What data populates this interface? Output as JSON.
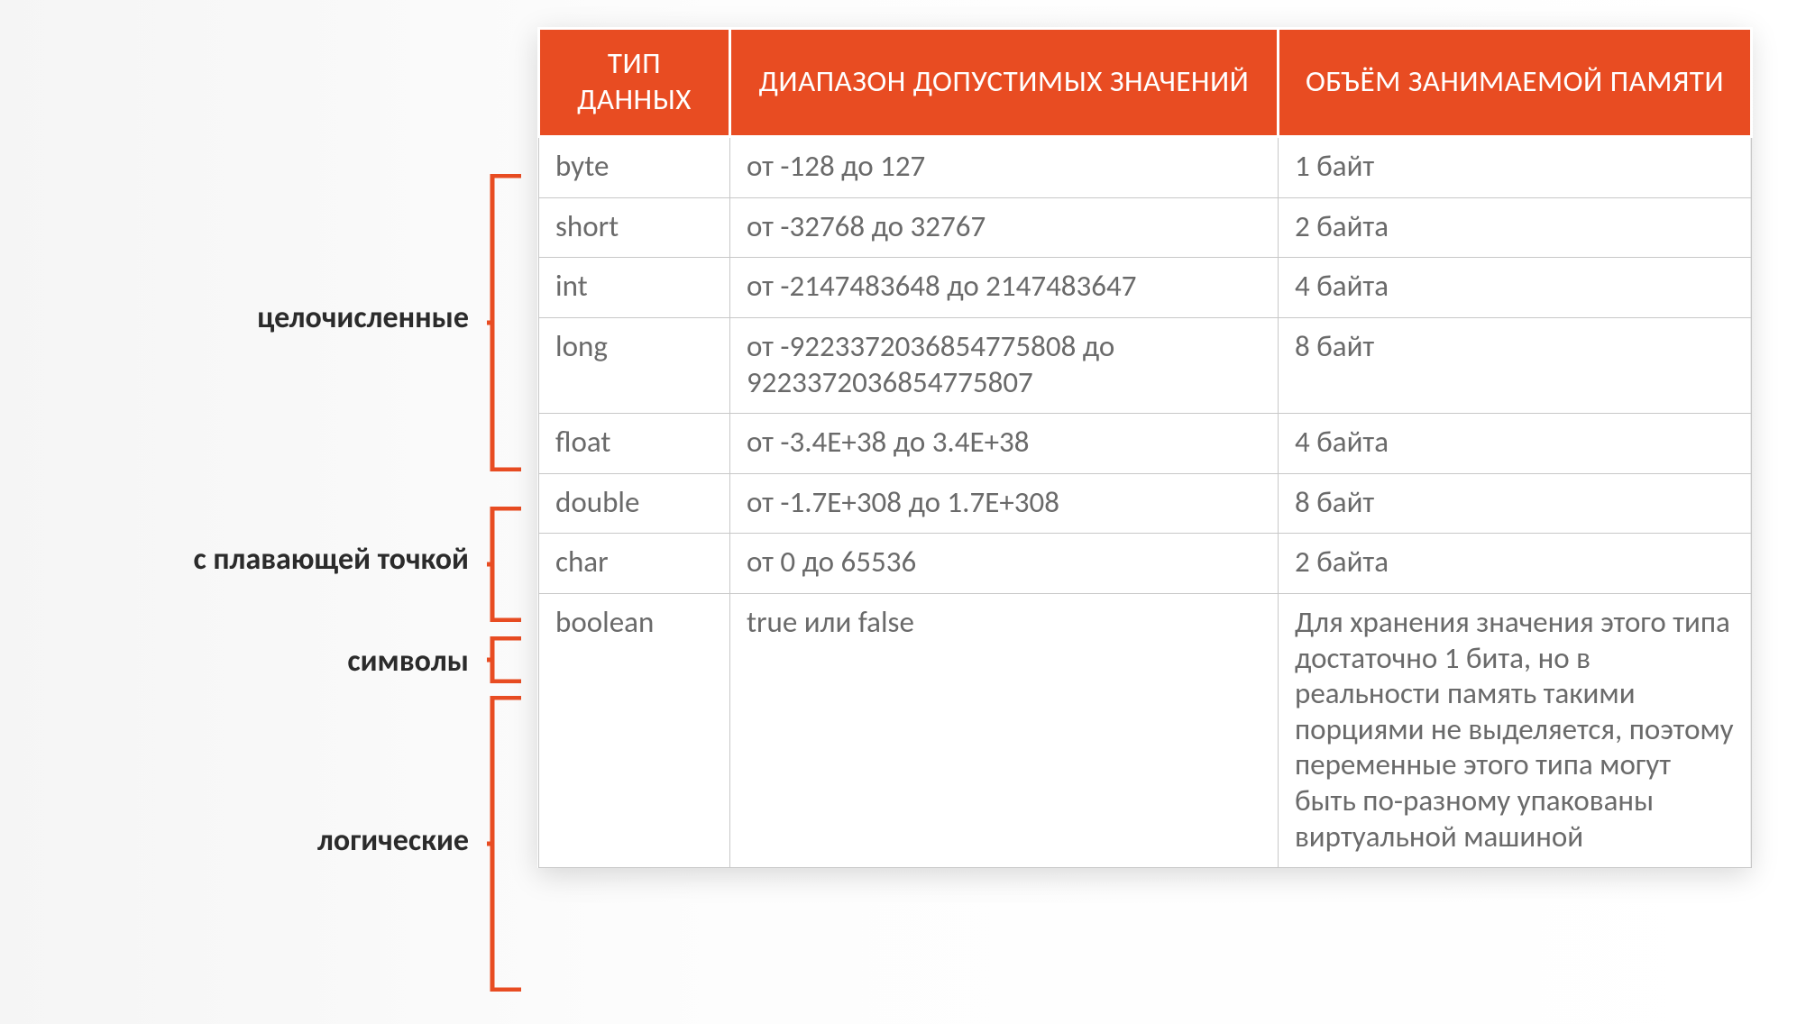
{
  "labels": {
    "integers": "целочисленные",
    "floating": "с плавающей точкой",
    "chars": "символы",
    "logical": "логические"
  },
  "table": {
    "headers": {
      "type": "ТИП ДАННЫХ",
      "range": "ДИАПАЗОН ДОПУСТИМЫХ ЗНАЧЕНИЙ",
      "memory": "ОБЪЁМ ЗАНИМАЕМОЙ ПАМЯТИ"
    },
    "rows": [
      {
        "type": "byte",
        "range": "от -128 до 127",
        "memory": "1 байт"
      },
      {
        "type": "short",
        "range": "от -32768 до 32767",
        "memory": "2 байта"
      },
      {
        "type": "int",
        "range": "от -2147483648 до 2147483647",
        "memory": "4 байта"
      },
      {
        "type": "long",
        "range": "от -9223372036854775808 до 9223372036854775807",
        "memory": "8 байт"
      },
      {
        "type": "float",
        "range": "от -3.4E+38 до 3.4E+38",
        "memory": "4 байта"
      },
      {
        "type": "double",
        "range": "от -1.7E+308 до 1.7E+308",
        "memory": "8 байт"
      },
      {
        "type": "char",
        "range": "от 0 до 65536",
        "memory": "2 байта"
      },
      {
        "type": "boolean",
        "range": "true или false",
        "memory": "Для хранения значения этого типа достаточно 1 бита, но в реальности память такими порциями не выделяется, поэтому переменные этого типа могут быть по-разному упакованы виртуальной машиной"
      }
    ]
  }
}
